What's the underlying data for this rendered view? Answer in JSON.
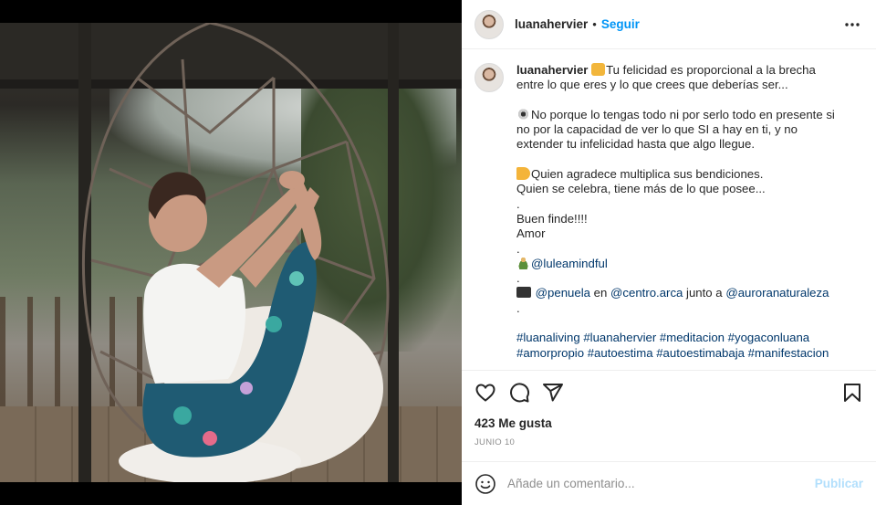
{
  "post": {
    "username": "luanahervier",
    "separator": "•",
    "follow_label": "Seguir",
    "more_label": "•••"
  },
  "caption": {
    "username": "luanahervier",
    "lines": [
      {
        "emoji": "raising-hands",
        "text": "Tu felicidad es proporcional a la brecha entre lo que eres y lo que crees que deberías ser..."
      },
      {
        "emoji": "eye",
        "text": "No porque lo tengas todo ni por serlo todo en presente si no por la capacidad de ver lo que SI a hay en ti, y no extender tu infelicidad hasta que algo llegue."
      },
      {
        "emoji": "pointing-hand",
        "text": "Quien agradece multiplica sus bendiciones."
      },
      {
        "text": "Quien se celebra, tiene más de lo que posee..."
      },
      {
        "text": "."
      },
      {
        "text": "Buen finde!!!!"
      },
      {
        "text": "Amor"
      },
      {
        "text": "."
      },
      {
        "emoji": "yoga-person",
        "mention": "@luleamindful"
      },
      {
        "text": "."
      },
      {
        "emoji": "camera",
        "mentions": [
          "@penuela",
          "@centro.arca",
          "@auroranaturaleza"
        ],
        "words": [
          "en",
          "junto a"
        ]
      },
      {
        "text": "."
      },
      {
        "hashtags": "#luanaliving #luanahervier #meditacion #yogaconluana #amorpropio #autoestima #autoestimabaja #manifestacion"
      }
    ]
  },
  "actions": {
    "like_icon": "heart-icon",
    "comment_icon": "comment-icon",
    "share_icon": "share-icon",
    "save_icon": "bookmark-icon"
  },
  "likes": "423 Me gusta",
  "date": "JUNIO 10",
  "comment": {
    "placeholder": "Añade un comentario...",
    "post_label": "Publicar",
    "emoji_icon": "smiley-icon"
  },
  "colors": {
    "link": "#0095f6",
    "mention": "#00376b",
    "post_disabled": "#b2dffc",
    "muted": "#8e8e8e"
  }
}
